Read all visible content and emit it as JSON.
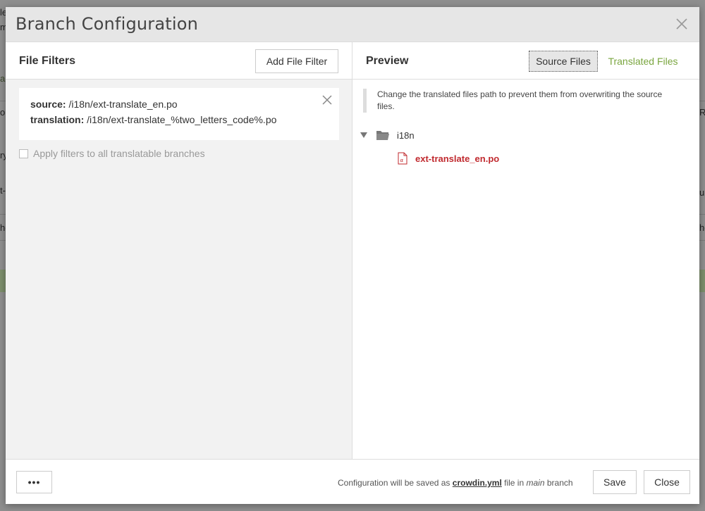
{
  "background": {
    "fragments_left": [
      "le",
      "m",
      "al",
      "o",
      "ry",
      "t-",
      "ho"
    ],
    "fragments_right": [
      "R",
      "u",
      "ho"
    ]
  },
  "dialog": {
    "title": "Branch Configuration",
    "close_icon": "close-icon"
  },
  "left_panel": {
    "title": "File Filters",
    "add_button": "Add File Filter",
    "filter": {
      "source_label": "source:",
      "source_value": "/i18n/ext-translate_en.po",
      "translation_label": "translation:",
      "translation_value": "/i18n/ext-translate_%two_letters_code%.po"
    },
    "apply_checkbox_label": "Apply filters to all translatable branches",
    "apply_checked": false
  },
  "right_panel": {
    "title": "Preview",
    "tabs": [
      {
        "label": "Source Files",
        "active": true
      },
      {
        "label": "Translated Files",
        "active": false
      }
    ],
    "notice": "Change the translated files path to prevent them from overwriting the source files.",
    "tree": {
      "folder": "i18n",
      "file": "ext-translate_en.po"
    }
  },
  "footer": {
    "more_button": "•••",
    "note_prefix": "Configuration will be saved as",
    "note_file": "crowdin.yml",
    "note_middle": "file in",
    "note_branch": "main",
    "note_suffix": "branch",
    "save_button": "Save",
    "close_button": "Close"
  },
  "colors": {
    "accent_green": "#7aa63f",
    "file_red": "#c0292e",
    "overlay": "#8f8f8f"
  }
}
